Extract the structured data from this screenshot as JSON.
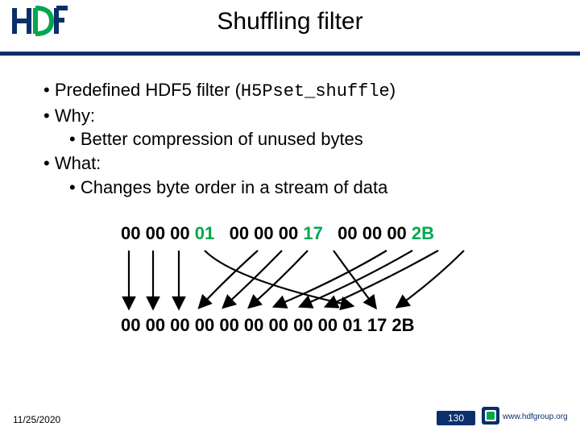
{
  "title": "Shuffling filter",
  "bullets": {
    "b1a": "Predefined HDF5 filter (",
    "b1code": "H5Pset_shuffle",
    "b1b": ")",
    "b2": "Why:",
    "b2_1": "Better compression of unused bytes",
    "b3": "What:",
    "b3_1": "Changes byte order in a stream of data"
  },
  "bytes": {
    "g1": "00 00 00 ",
    "g1last": "01",
    "gap1": "   ",
    "g2": "00 00 00 ",
    "g2last": "17",
    "gap2": "   ",
    "g3": "00 00 00 ",
    "g3last": "2B",
    "out_a": "00 00 00 ",
    "out_b": "00 00 00 00 00 00 01 17 2B"
  },
  "footer": {
    "date": "11/25/2020",
    "page": "130",
    "url": "www.hdfgroup.org"
  },
  "colors": {
    "brand_blue": "#0a2f6b",
    "brand_green": "#00a84f"
  }
}
